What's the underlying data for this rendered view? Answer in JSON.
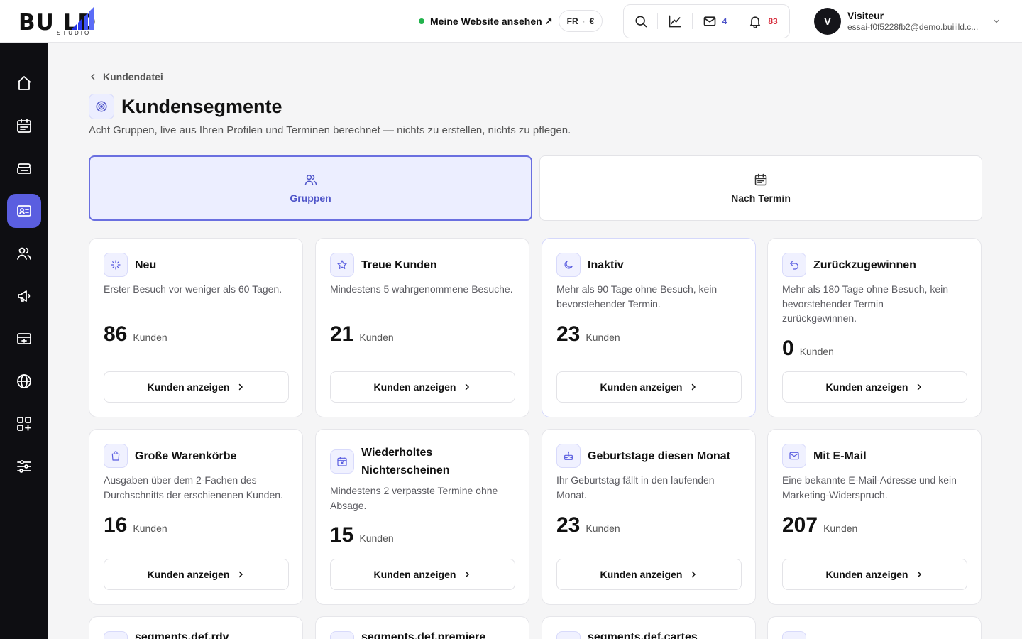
{
  "header": {
    "logo_text": "BU LD",
    "logo_sub": "STUDIO",
    "site_link": "Meine Website ansehen",
    "site_link_arrow": "↗",
    "lang": "FR",
    "currency": "€",
    "mail_count": "4",
    "notif_count": "83",
    "user_name": "Visiteur",
    "user_email": "essai-f0f5228fb2@demo.buiiild.c...",
    "avatar_letter": "V"
  },
  "colors": {
    "accent": "#5a5ee0",
    "online": "#22b34c",
    "badge_mail": "#4f55c9",
    "badge_notif": "#d62b3a"
  },
  "sidebar": {
    "items": [
      {
        "icon": "home-icon"
      },
      {
        "icon": "calendar-icon"
      },
      {
        "icon": "register-icon"
      },
      {
        "icon": "client-card-icon",
        "active": true
      },
      {
        "icon": "users-icon"
      },
      {
        "icon": "megaphone-icon"
      },
      {
        "icon": "payment-card-icon"
      },
      {
        "icon": "globe-icon"
      },
      {
        "icon": "apps-icon"
      },
      {
        "icon": "settings-sliders-icon"
      }
    ]
  },
  "page": {
    "breadcrumb": "Kundendatei",
    "title": "Kundensegmente",
    "subtitle": "Acht Gruppen, live aus Ihren Profilen und Terminen berechnet — nichts zu erstellen, nichts zu pflegen.",
    "tabs": [
      {
        "label": "Gruppen",
        "active": true
      },
      {
        "label": "Nach Termin"
      }
    ]
  },
  "segments": [
    {
      "title": "Neu",
      "desc": "Erster Besuch vor weniger als 60 Tagen.",
      "count": "86",
      "unit": "Kunden",
      "button": "Kunden anzeigen"
    },
    {
      "title": "Treue Kunden",
      "desc": "Mindestens 5 wahrgenommene Besuche.",
      "count": "21",
      "unit": "Kunden",
      "button": "Kunden anzeigen"
    },
    {
      "title": "Inaktiv",
      "desc": "Mehr als 90 Tage ohne Besuch, kein bevorstehender Termin.",
      "count": "23",
      "unit": "Kunden",
      "button": "Kunden anzeigen"
    },
    {
      "title": "Zurückzugewinnen",
      "desc": "Mehr als 180 Tage ohne Besuch, kein bevorstehender Termin — zurückgewinnen.",
      "count": "0",
      "unit": "Kunden",
      "button": "Kunden anzeigen"
    },
    {
      "title": "Große Warenkörbe",
      "desc": "Ausgaben über dem 2-Fachen des Durchschnitts der erschienenen Kunden.",
      "count": "16",
      "unit": "Kunden",
      "button": "Kunden anzeigen"
    },
    {
      "title": "Wiederholtes Nichterscheinen",
      "desc": "Mindestens 2 verpasste Termine ohne Absage.",
      "count": "15",
      "unit": "Kunden",
      "button": "Kunden anzeigen"
    },
    {
      "title": "Geburtstage diesen Monat",
      "desc": "Ihr Geburtstag fällt in den laufenden Monat.",
      "count": "23",
      "unit": "Kunden",
      "button": "Kunden anzeigen"
    },
    {
      "title": "Mit E-Mail",
      "desc": "Eine bekannte E-Mail-Adresse und kein Marketing-Widerspruch.",
      "count": "207",
      "unit": "Kunden",
      "button": "Kunden anzeigen"
    }
  ],
  "partial_cards": [
    {
      "title": "segments.def.rdv"
    },
    {
      "title": "segments.def.premiere"
    },
    {
      "title": "segments.def.cartes"
    },
    {
      "title": ""
    }
  ]
}
